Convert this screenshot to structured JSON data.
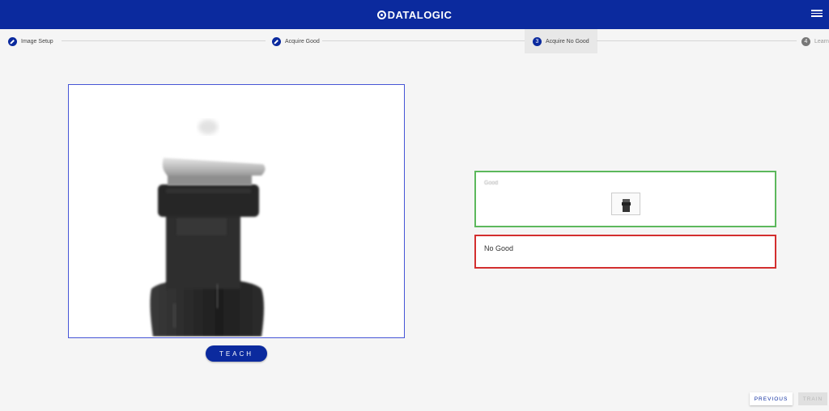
{
  "brand": {
    "name": "DATALOGIC"
  },
  "stepper": {
    "steps": [
      {
        "label": "Image Setup",
        "state": "done",
        "icon": "pencil-icon"
      },
      {
        "label": "Acquire Good",
        "state": "done",
        "icon": "pencil-icon"
      },
      {
        "label": "Acquire No Good",
        "state": "active",
        "number": "3"
      },
      {
        "label": "Learn",
        "state": "pending",
        "number": "4"
      }
    ]
  },
  "teach_button": {
    "label": "TEACH"
  },
  "classes": {
    "good": {
      "label": "Good",
      "color": "#5cb85c"
    },
    "no_good": {
      "label": "No Good",
      "color": "#d32f2f"
    }
  },
  "footer": {
    "previous_label": "PREVIOUS",
    "train_label": "TRAIN"
  },
  "colors": {
    "primary": "#0b2a9e",
    "frame_border": "#4655d6"
  }
}
